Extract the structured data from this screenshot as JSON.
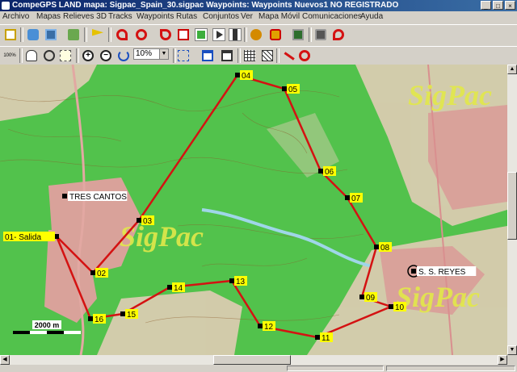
{
  "window": {
    "title": "CompeGPS LAND mapa: Sigpac_Spain_30.sigpac Waypoints:  Waypoints Nuevos1 NO REGISTRADO"
  },
  "menu": [
    "Archivo",
    "Mapas",
    "Relieves 3D",
    "Tracks",
    "Waypoints",
    "Rutas",
    "Conjuntos",
    "Ver",
    "Mapa Móvil",
    "Comunicaciones",
    "Ayuda"
  ],
  "toolbar2": {
    "zoom_value": "10%",
    "zoom_100_label": "100%"
  },
  "map": {
    "watermark": "SigPac",
    "scale_label": "2000 m",
    "towns": [
      {
        "name": "TRES CANTOS"
      },
      {
        "name": "S. S. REYES"
      }
    ],
    "waypoints": [
      {
        "label": "01- Salida"
      },
      {
        "label": "02"
      },
      {
        "label": "03"
      },
      {
        "label": "04"
      },
      {
        "label": "05"
      },
      {
        "label": "06"
      },
      {
        "label": "07"
      },
      {
        "label": "08"
      },
      {
        "label": "09"
      },
      {
        "label": "10"
      },
      {
        "label": "11"
      },
      {
        "label": "12"
      },
      {
        "label": "13"
      },
      {
        "label": "14"
      },
      {
        "label": "15"
      },
      {
        "label": "16"
      }
    ],
    "colors": {
      "forest": "#52c24c",
      "track": "#d41212",
      "label_bg": "#ffff00",
      "town": "#d9a29a",
      "river": "#9fd6e8",
      "watermark": "#e2e84a"
    }
  }
}
